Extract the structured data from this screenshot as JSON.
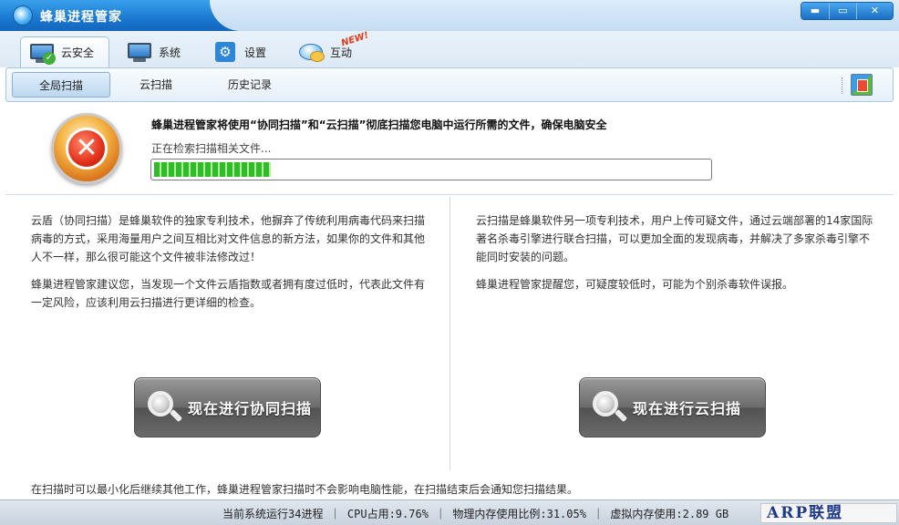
{
  "window": {
    "title": "蜂巢进程管家",
    "buttons": {
      "minimize": "▬",
      "maximize": "▭",
      "close": "✕"
    }
  },
  "main_tabs": [
    {
      "label": "云安全",
      "icon": "cloud-security-monitor-icon",
      "active": true
    },
    {
      "label": "系统",
      "icon": "monitor-icon",
      "active": false
    },
    {
      "label": "设置",
      "icon": "settings-icon",
      "active": false
    },
    {
      "label": "互动",
      "icon": "chat-icon",
      "active": false,
      "badge": "NEW!"
    }
  ],
  "sub_tabs": [
    {
      "label": "全局扫描",
      "active": true
    },
    {
      "label": "云扫描",
      "active": false
    },
    {
      "label": "历史记录",
      "active": false
    }
  ],
  "scan": {
    "title": "蜂巢进程管家将使用“协同扫描”和“云扫描”彻底扫描您电脑中运行所需的文件，确保电脑安全",
    "status": "正在检索扫描相关文件...",
    "progress_fraction": 0.21
  },
  "left_panel": {
    "para1": "云盾（协同扫描）是蜂巢软件的独家专利技术，他摒弃了传统利用病毒代码来扫描病毒的方式，采用海量用户之间互相比对文件信息的新方法，如果你的文件和其他人不一样，那么很可能这个文件被非法修改过！",
    "para2": "蜂巢进程管家建议您，当发现一个文件云盾指数或者拥有度过低时，代表此文件有一定风险，应该利用云扫描进行更详细的检查。",
    "button": "现在进行协同扫描"
  },
  "right_panel": {
    "para1": "云扫描是蜂巢软件另一项专利技术，用户上传可疑文件，通过云端部署的14家国际著名杀毒引擎进行联合扫描，可以更加全面的发现病毒，并解决了多家杀毒引擎不能同时安装的问题。",
    "para2": "蜂巢进程管家提醒您，可疑度较低时，可能为个别杀毒软件误报。",
    "button": "现在进行云扫描"
  },
  "footer_note": "在扫描时可以最小化后继续其他工作，蜂巢进程管家扫描时不会影响电脑性能，在扫描结束后会通知您扫描结果。",
  "statusbar": {
    "text": "当前系统运行34进程 ｜ CPU占用:9.76% ｜ 物理内存使用比例:31.05% ｜ 虚拟内存使用:2.89 GB",
    "logo": "ARP联盟"
  }
}
